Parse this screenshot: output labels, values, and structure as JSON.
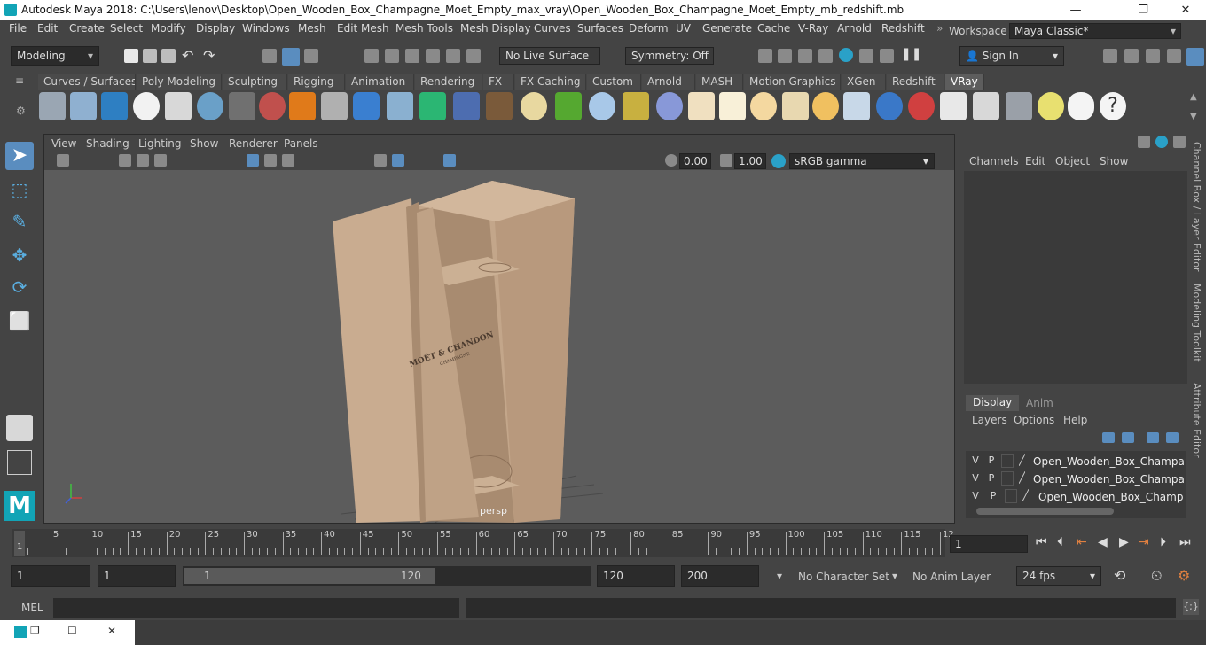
{
  "window": {
    "title": "Autodesk Maya 2018: C:\\Users\\lenov\\Desktop\\Open_Wooden_Box_Champagne_Moet_Empty_max_vray\\Open_Wooden_Box_Champagne_Moet_Empty_mb_redshift.mb",
    "minimize": "—",
    "maximize": "❐",
    "close": "✕"
  },
  "menu": [
    "File",
    "Edit",
    "Create",
    "Select",
    "Modify",
    "Display",
    "Windows",
    "Mesh",
    "Edit Mesh",
    "Mesh Tools",
    "Mesh Display",
    "Curves",
    "Surfaces",
    "Deform",
    "UV",
    "Generate",
    "Cache",
    "V-Ray",
    "Arnold",
    "Redshift"
  ],
  "workspace": {
    "label": "Workspace :",
    "value": "Maya Classic*"
  },
  "toolbar": {
    "mode": "Modeling",
    "live_surface": "No Live Surface",
    "symmetry": "Symmetry: Off",
    "sign_in": "Sign In"
  },
  "shelf_tabs": [
    "Curves / Surfaces",
    "Poly Modeling",
    "Sculpting",
    "Rigging",
    "Animation",
    "Rendering",
    "FX",
    "FX Caching",
    "Custom",
    "Arnold",
    "MASH",
    "Motion Graphics",
    "XGen",
    "Redshift",
    "VRay"
  ],
  "active_shelf_tab": "VRay",
  "viewport": {
    "menu": [
      "View",
      "Shading",
      "Lighting",
      "Show",
      "Renderer",
      "Panels"
    ],
    "exposure": "0.00",
    "gamma": "1.00",
    "color_space": "sRGB gamma",
    "camera_label": "persp",
    "logo_text_1": "MOËT & CHANDON",
    "logo_text_2": "CHAMPAGNE"
  },
  "channel_box": {
    "menu": [
      "Channels",
      "Edit",
      "Object",
      "Show"
    ],
    "tabs": [
      "Display",
      "Anim"
    ],
    "layer_menu": [
      "Layers",
      "Options",
      "Help"
    ],
    "layers": [
      {
        "v": "V",
        "p": "P",
        "name": "Open_Wooden_Box_Champagne_"
      },
      {
        "v": "V",
        "p": "P",
        "name": "Open_Wooden_Box_Champagne_"
      },
      {
        "v": "V",
        "p": "P",
        "name": "Open_Wooden_Box_Champagne"
      }
    ]
  },
  "side_tabs": [
    "Channel Box / Layer Editor",
    "Modeling Toolkit",
    "Attribute Editor"
  ],
  "timeline": {
    "ticks": [
      "5",
      "10",
      "15",
      "20",
      "25",
      "30",
      "35",
      "40",
      "45",
      "50",
      "55",
      "60",
      "65",
      "70",
      "75",
      "80",
      "85",
      "90",
      "95",
      "100",
      "105",
      "110",
      "115",
      "12"
    ],
    "start_marker": "1",
    "current_frame": "1"
  },
  "range": {
    "start": "1",
    "playback_start": "1",
    "slider_start": "1",
    "slider_end": "120",
    "playback_end": "120",
    "end": "200",
    "character_set": "No Character Set",
    "anim_layer": "No Anim Layer",
    "fps": "24 fps"
  },
  "command": {
    "label": "MEL"
  }
}
